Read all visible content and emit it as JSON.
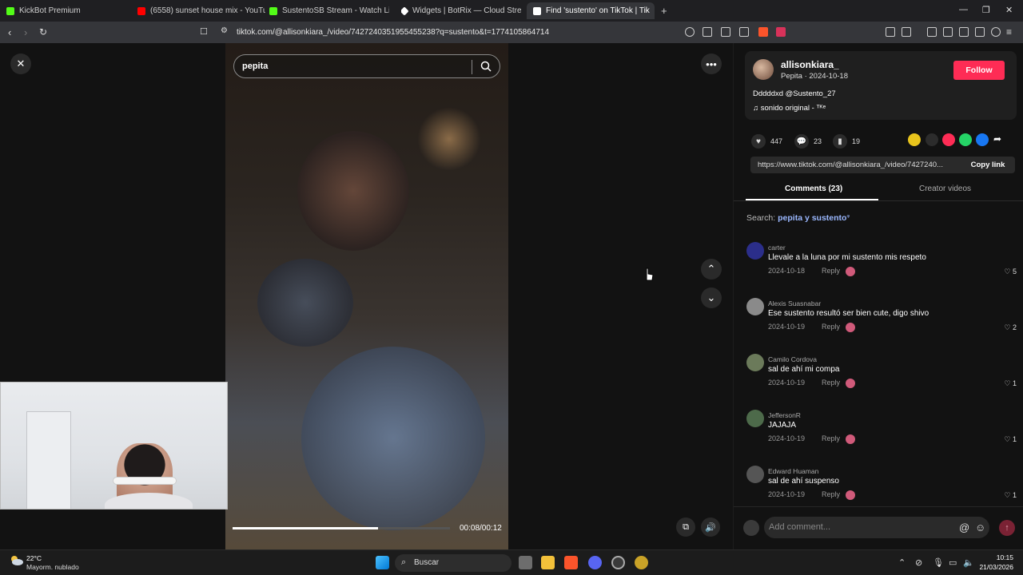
{
  "browser": {
    "tabs": [
      {
        "title": "KickBot Premium",
        "favicon_color": "#53fc18"
      },
      {
        "title": "(6558) sunset house mix - YouTube",
        "favicon_color": "#ff0000"
      },
      {
        "title": "SustentoSB Stream - Watch Live",
        "favicon_color": "#53fc18"
      },
      {
        "title": "Widgets | BotRix — Cloud Streaming",
        "favicon_color": "#ffffff"
      },
      {
        "title": "Find 'sustento' on TikTok | Tik",
        "favicon_color": "#ffffff"
      }
    ],
    "new_tab": "+",
    "url": "tiktok.com/@allisonkiara_/video/7427240351955455238?q=sustento&t=1774105864714"
  },
  "video": {
    "search_query": "pepita",
    "timecode": "00:08/00:12",
    "progress_fraction": 0.67
  },
  "post": {
    "username": "allisonkiara_",
    "subtitle": "Pepita · 2024-10-18",
    "follow_label": "Follow",
    "description": "Dddddxd @Sustento_27",
    "music": "sonido original - ᵀᴷᵉ",
    "likes": "447",
    "comments_count": "23",
    "saves": "19",
    "link": "https://www.tiktok.com/@allisonkiara_/video/7427240...",
    "copy_label": "Copy link"
  },
  "tabs": {
    "comments": "Comments (23)",
    "creator": "Creator videos"
  },
  "search_hint": {
    "prefix": "Search: ",
    "keyword": "pepita y sustento",
    "suffix": "ᵠ"
  },
  "comments": [
    {
      "name": "carter",
      "text": "Llevale a la luna por mi sustento mis respeto",
      "date": "2024-10-18",
      "reply": "Reply",
      "likes": "5",
      "avatar_color": "#2b2e8a"
    },
    {
      "name": "Alexis Suasnabar",
      "text": "Ese sustento resultó ser bien cute, digo shivo",
      "date": "2024-10-19",
      "reply": "Reply",
      "likes": "2",
      "avatar_color": "#8a8a8a"
    },
    {
      "name": "Camilo Cordova",
      "text": "sal de ahí mi compa",
      "date": "2024-10-19",
      "reply": "Reply",
      "likes": "1",
      "avatar_color": "#6b7a5a"
    },
    {
      "name": "JeffersonR",
      "text": "JAJAJA",
      "date": "2024-10-19",
      "reply": "Reply",
      "likes": "1",
      "avatar_color": "#4d6a4a"
    },
    {
      "name": "Edward Huaman",
      "text": "sal de ahí suspenso",
      "date": "2024-10-19",
      "reply": "Reply",
      "likes": "1",
      "avatar_color": "#555555"
    }
  ],
  "comment_input": {
    "placeholder": "Add comment..."
  },
  "taskbar": {
    "temp": "22°C",
    "weather": "Mayorm. nublado",
    "search_placeholder": "Buscar",
    "time": "10:15",
    "date": "21/03/2026"
  }
}
